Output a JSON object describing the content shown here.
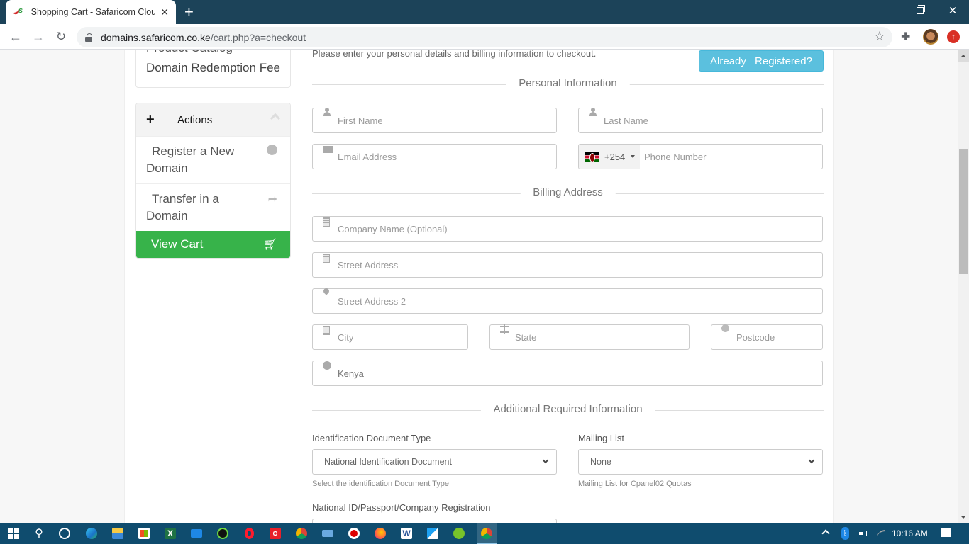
{
  "browser": {
    "tab_title": "Shopping Cart - Safaricom Cloud",
    "url_host": "domains.safaricom.co.ke",
    "url_path": "/cart.php?a=checkout"
  },
  "sidebar": {
    "categories_partial": "Product Catalog",
    "category_item": "Domain Redemption Fee",
    "actions_title": "Actions",
    "actions": [
      {
        "label": "Register a New Domain",
        "icon": "globe-icon"
      },
      {
        "label": "Transfer in a Domain",
        "icon": "share-icon"
      },
      {
        "label": "View Cart",
        "icon": "shopping-cart-icon"
      }
    ]
  },
  "main": {
    "intro": "Please enter your personal details and billing information to checkout.",
    "already_registered": "Already Registered?",
    "sections": {
      "personal": "Personal Information",
      "billing": "Billing Address",
      "additional": "Additional Required Information"
    },
    "fields": {
      "first_name": {
        "placeholder": "First Name",
        "value": ""
      },
      "last_name": {
        "placeholder": "Last Name",
        "value": ""
      },
      "email": {
        "placeholder": "Email Address",
        "value": ""
      },
      "phone_code": "+254",
      "phone_country": "Kenya",
      "phone": {
        "placeholder": "Phone Number",
        "value": ""
      },
      "company": {
        "placeholder": "Company Name (Optional)",
        "value": ""
      },
      "street1": {
        "placeholder": "Street Address",
        "value": ""
      },
      "street2": {
        "placeholder": "Street Address 2",
        "value": ""
      },
      "city": {
        "placeholder": "City",
        "value": ""
      },
      "state": {
        "placeholder": "State",
        "value": ""
      },
      "postcode": {
        "placeholder": "Postcode",
        "value": ""
      },
      "country": "Kenya"
    },
    "additional": {
      "id_type_label": "Identification Document Type",
      "id_type_value": "National Identification Document",
      "id_type_help": "Select the identification Document Type",
      "mailing_label": "Mailing List",
      "mailing_value": "None",
      "mailing_help": "Mailing List for Cpanel02 Quotas",
      "national_id_label": "National ID/Passport/Company Registration"
    }
  },
  "taskbar": {
    "time": "10:16 AM",
    "apps": [
      "start",
      "search",
      "cortana",
      "edge",
      "file-explorer",
      "store",
      "excel",
      "mail",
      "upwork",
      "opera",
      "target-app",
      "chrome",
      "keyboard",
      "recorder",
      "firefox",
      "word",
      "app-a",
      "utorrent",
      "chrome-active"
    ]
  },
  "colors": {
    "titlebar": "#1c4359",
    "view_cart_green": "#37b34a",
    "info_button": "#5bc0de",
    "taskbar": "#0f4c6e"
  }
}
